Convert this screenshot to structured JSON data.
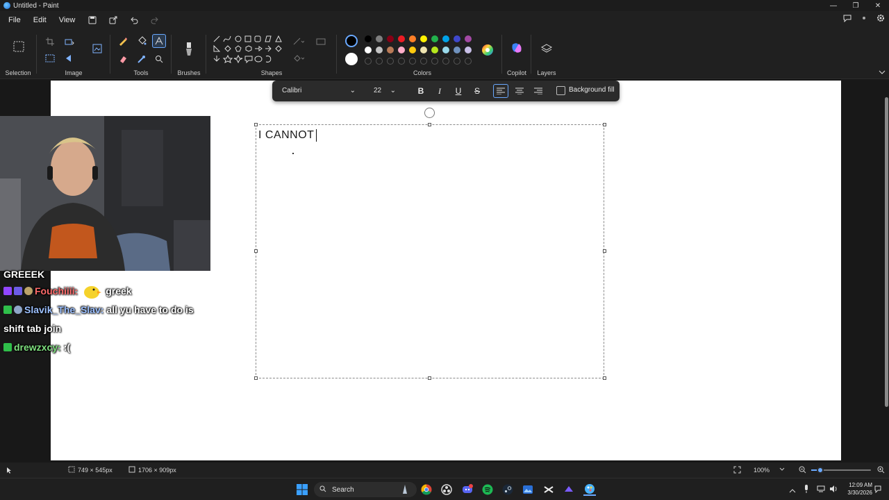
{
  "window": {
    "title": "Untitled - Paint"
  },
  "menu": {
    "file": "File",
    "edit": "Edit",
    "view": "View"
  },
  "ribbon": {
    "selection": "Selection",
    "image": "Image",
    "tools": "Tools",
    "brushes": "Brushes",
    "shapes": "Shapes",
    "colors": "Colors",
    "copilot": "Copilot",
    "layers": "Layers",
    "palette_row1": [
      "#000000",
      "#7f7f7f",
      "#880015",
      "#ed1c24",
      "#ff7f27",
      "#fff200",
      "#22b14c",
      "#00a2e8",
      "#3f48cc",
      "#a349a4"
    ],
    "palette_row2": [
      "#ffffff",
      "#c3c3c3",
      "#b97a57",
      "#ffaec9",
      "#ffc90e",
      "#efe4b0",
      "#b5e61d",
      "#99d9ea",
      "#7092be",
      "#c8bfe7"
    ],
    "primary_color": "#000000",
    "secondary_color": "#ffffff"
  },
  "text_toolbar": {
    "font": "Calibri",
    "size": "22",
    "bold": "B",
    "italic": "I",
    "underline": "U",
    "strike": "S",
    "background_fill": "Background fill"
  },
  "canvas": {
    "text": "I CANNOT"
  },
  "chat": [
    {
      "user": "",
      "user_color": "#ffffff",
      "message": "GREEEK"
    },
    {
      "user": "Fouchiiii:",
      "user_color": "#ff6b6b",
      "message": "greek"
    },
    {
      "user": "Slavik_The_Slav:",
      "user_color": "#9cc0ff",
      "message": "all yu have to do is"
    },
    {
      "user": "",
      "user_color": "#ffffff",
      "message": "shift tab join"
    },
    {
      "user": "drewzxcy:",
      "user_color": "#7ee07e",
      "message": ":("
    }
  ],
  "status": {
    "selection_size": "749 × 545px",
    "canvas_size": "1706 × 909px",
    "zoom": "100%",
    "zoom_level": 0.15
  },
  "taskbar": {
    "search": "Search",
    "time": "12:09 AM",
    "date": "3/30/2026"
  }
}
